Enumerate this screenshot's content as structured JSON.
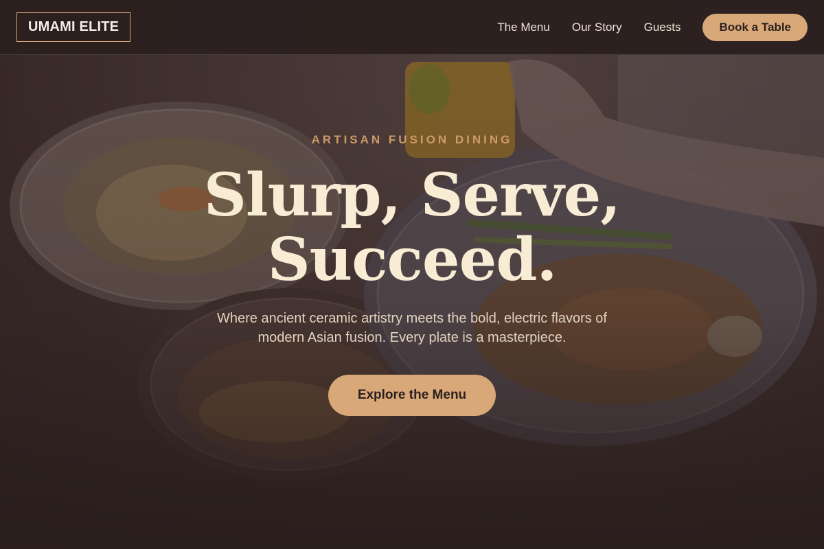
{
  "header": {
    "logo": "UMAMI ELITE",
    "nav": [
      {
        "label": "The Menu"
      },
      {
        "label": "Our Story"
      },
      {
        "label": "Guests"
      }
    ],
    "cta_label": "Book a Table"
  },
  "hero": {
    "eyebrow": "ARTISAN FUSION DINING",
    "headline_line1": "Slurp, Serve,",
    "headline_line2": "Succeed.",
    "subtext_line1": "Where ancient ceramic artistry meets the bold, electric flavors of",
    "subtext_line2": "modern Asian fusion. Every plate is a masterpiece.",
    "cta_label": "Explore the Menu"
  },
  "colors": {
    "background": "#2c201f",
    "accent": "#d8a878",
    "eyebrow": "#d09a6a",
    "headline": "#f8ecd4",
    "body_text": "#e2d2c0"
  }
}
